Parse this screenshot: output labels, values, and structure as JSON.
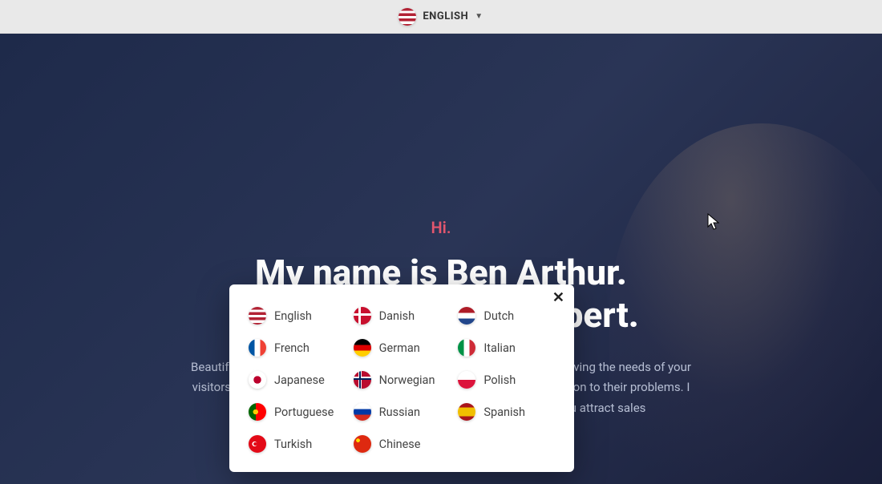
{
  "topbar": {
    "current_lang_label": "ENGLISH",
    "caret": "▼"
  },
  "hero": {
    "greet": "Hi.",
    "headline_line1": "My name is Ben Arthur.",
    "headline_line2": "Digital Marketing Expert.",
    "subtext": "Beautiful websites and stunning designs won't help you if they're not serving the needs of your visitors. Your potential customers are looking for the most simple solution to their problems. I gather them. I talk to them. I analyze their behavior and help you attract sales"
  },
  "popover": {
    "close": "✕",
    "langs": [
      {
        "label": "English",
        "flag": "us"
      },
      {
        "label": "Danish",
        "flag": "dk"
      },
      {
        "label": "Dutch",
        "flag": "nl"
      },
      {
        "label": "French",
        "flag": "fr"
      },
      {
        "label": "German",
        "flag": "de"
      },
      {
        "label": "Italian",
        "flag": "it"
      },
      {
        "label": "Japanese",
        "flag": "jp"
      },
      {
        "label": "Norwegian",
        "flag": "no"
      },
      {
        "label": "Polish",
        "flag": "pl"
      },
      {
        "label": "Portuguese",
        "flag": "pt"
      },
      {
        "label": "Russian",
        "flag": "ru"
      },
      {
        "label": "Spanish",
        "flag": "es"
      },
      {
        "label": "Turkish",
        "flag": "tr"
      },
      {
        "label": "Chinese",
        "flag": "cn"
      }
    ]
  }
}
